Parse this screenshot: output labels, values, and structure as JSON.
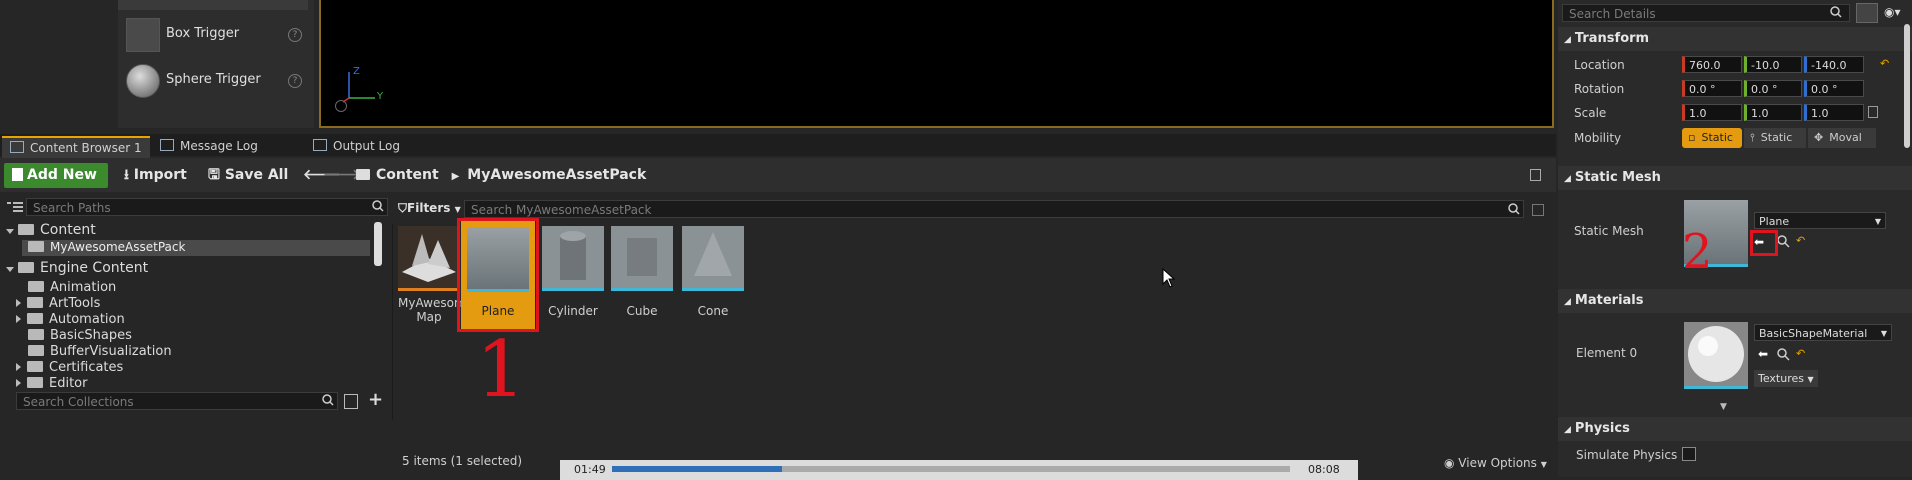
{
  "place_actors": {
    "items": [
      {
        "label": "Box Trigger",
        "help": "?"
      },
      {
        "label": "Sphere Trigger",
        "help": "?"
      }
    ]
  },
  "viewport": {
    "axis_y": "Y",
    "axis_z": "Z"
  },
  "tabs": [
    {
      "label": "Content Browser 1"
    },
    {
      "label": "Message Log"
    },
    {
      "label": "Output Log"
    }
  ],
  "toolbar": {
    "add_new": "Add New",
    "import": "Import",
    "save_all": "Save All",
    "breadcrumb": [
      "Content",
      "MyAwesomeAssetPack"
    ]
  },
  "paths": {
    "search_placeholder": "Search Paths",
    "collections_placeholder": "Search Collections",
    "tree": [
      {
        "label": "Content",
        "level": 0,
        "expanded": true
      },
      {
        "label": "MyAwesomeAssetPack",
        "level": 1,
        "selected": true
      },
      {
        "label": "Engine Content",
        "level": 0,
        "expanded": true
      },
      {
        "label": "Animation",
        "level": 1
      },
      {
        "label": "ArtTools",
        "level": 1,
        "collapsed": true
      },
      {
        "label": "Automation",
        "level": 1,
        "collapsed": true
      },
      {
        "label": "BasicShapes",
        "level": 1
      },
      {
        "label": "BufferVisualization",
        "level": 1
      },
      {
        "label": "Certificates",
        "level": 1,
        "collapsed": true
      },
      {
        "label": "Editor",
        "level": 1,
        "collapsed": true
      }
    ]
  },
  "assets": {
    "filters": "Filters",
    "search_placeholder": "Search MyAwesomeAssetPack",
    "items": [
      {
        "label": "MyAwesome Map",
        "line1": "MyAwesome",
        "line2": "Map"
      },
      {
        "label": "Plane",
        "selected": true
      },
      {
        "label": "Cylinder"
      },
      {
        "label": "Cube"
      },
      {
        "label": "Cone"
      }
    ],
    "status": "5 items (1 selected)",
    "view_options": "View Options",
    "time_start": "01:49",
    "time_end": "08:08",
    "progress": 0.25
  },
  "annotations": {
    "mark1": "1",
    "mark2": "2"
  },
  "details": {
    "search_placeholder": "Search Details",
    "transform": {
      "title": "Transform",
      "location_label": "Location",
      "location": [
        "760.0",
        "-10.0",
        "-140.0"
      ],
      "rotation_label": "Rotation",
      "rotation": [
        "0.0 °",
        "0.0 °",
        "0.0 °"
      ],
      "scale_label": "Scale",
      "scale": [
        "1.0",
        "1.0",
        "1.0"
      ],
      "mobility_label": "Mobility",
      "mobility": [
        "Static",
        "Static",
        "Moval"
      ]
    },
    "static_mesh": {
      "title": "Static Mesh",
      "label": "Static Mesh",
      "value": "Plane"
    },
    "materials": {
      "title": "Materials",
      "element_label": "Element 0",
      "value": "BasicShapeMaterial",
      "textures": "Textures"
    },
    "physics": {
      "title": "Physics",
      "simulate": "Simulate Physics"
    }
  },
  "colors": {
    "accent": "#e8a400",
    "addnew": "#3c8a2e",
    "annotation": "#e0141e"
  }
}
